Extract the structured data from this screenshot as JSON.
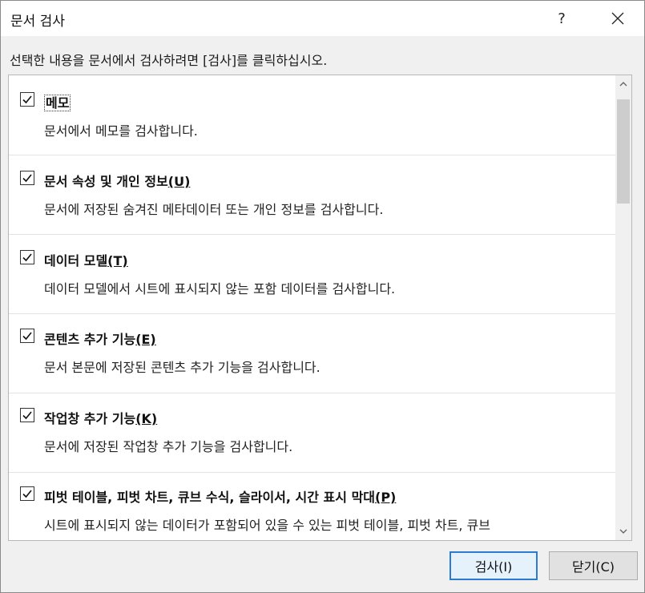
{
  "window": {
    "title": "문서 검사",
    "help_label": "?"
  },
  "instruction": "선택한 내용을 문서에서 검사하려면 [검사]를 클릭하십시오.",
  "items": [
    {
      "title": "메모",
      "mnemonic": "",
      "description": "문서에서 메모를 검사합니다.",
      "checked": true
    },
    {
      "title": "문서 속성 및 개인 정보",
      "mnemonic": "(U)",
      "description": "문서에 저장된 숨겨진 메타데이터 또는 개인 정보를 검사합니다.",
      "checked": true
    },
    {
      "title": "데이터 모델",
      "mnemonic": "(T)",
      "description": "데이터 모델에서 시트에 표시되지 않는 포함 데이터를 검사합니다.",
      "checked": true
    },
    {
      "title": "콘텐츠 추가 기능",
      "mnemonic": "(E)",
      "description": "문서 본문에 저장된 콘텐츠 추가 기능을 검사합니다.",
      "checked": true
    },
    {
      "title": "작업창 추가 기능",
      "mnemonic": "(K)",
      "description": "문서에 저장된 작업창 추가 기능을 검사합니다.",
      "checked": true
    },
    {
      "title": "피벗 테이블, 피벗 차트, 큐브 수식, 슬라이서, 시간 표시 막대",
      "mnemonic": "(P)",
      "description": "시트에 표시되지 않는 데이터가 포함되어 있을 수 있는 피벗 테이블, 피벗 차트, 큐브",
      "checked": true
    }
  ],
  "buttons": {
    "inspect_label": "검사(I)",
    "close_label": "닫기(C)"
  },
  "colors": {
    "accent": "#2b7bd4",
    "dialog_bg": "#f0f0f0"
  }
}
